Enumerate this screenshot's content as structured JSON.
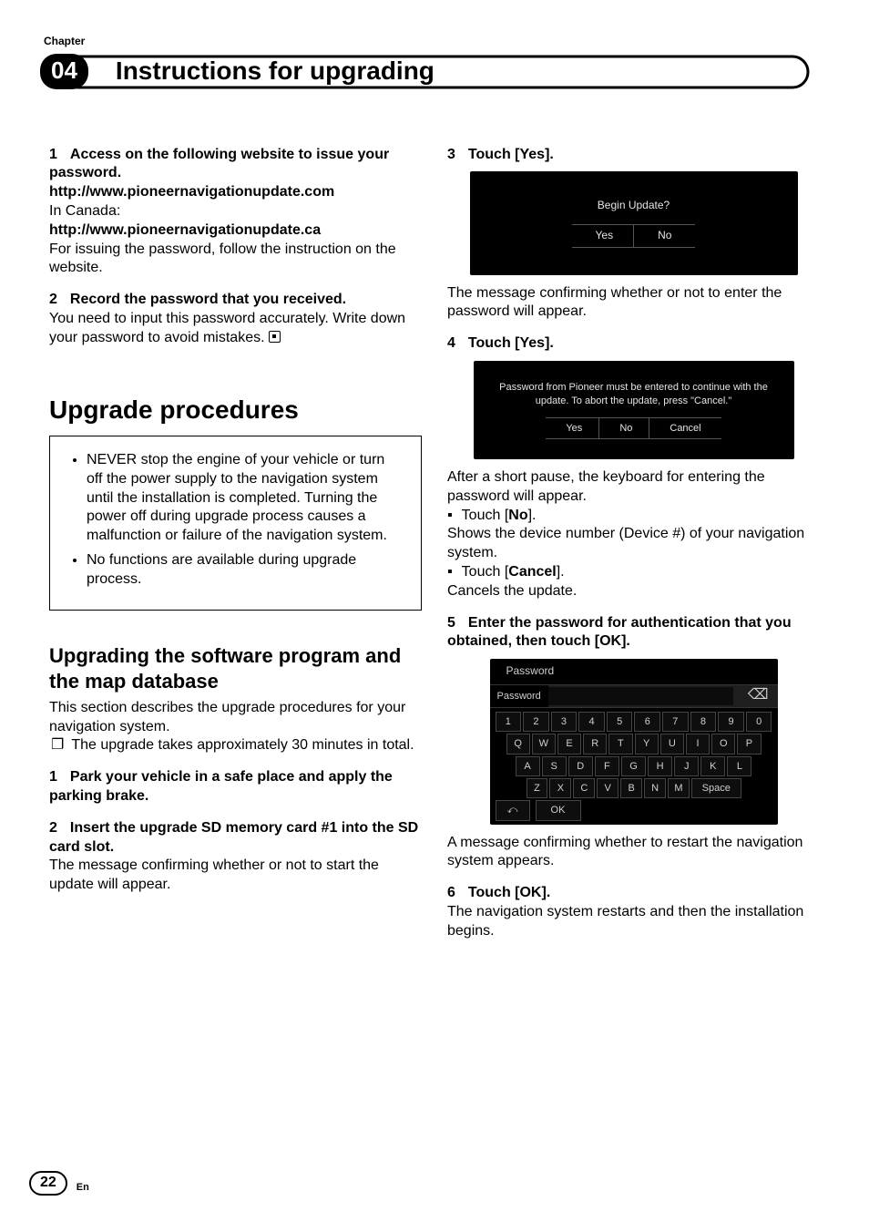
{
  "header": {
    "chapter_label": "Chapter",
    "chapter_num": "04",
    "title": "Instructions for upgrading"
  },
  "left": {
    "s1_heading": "Access on the following website to issue your password.",
    "s1_num": "1",
    "url_us": "http://www.pioneernavigationupdate.com",
    "canada_label": "In Canada:",
    "url_ca": "http://www.pioneernavigationupdate.ca",
    "s1_body": "For issuing the password, follow the instruction on the website.",
    "s2_num": "2",
    "s2_heading": "Record the password that you received.",
    "s2_body": "You need to input this password accurately. Write down your password to avoid mistakes.",
    "section_title": "Upgrade procedures",
    "caution1": "NEVER stop the engine of your vehicle or turn off the power supply to the navigation system until the installation is completed. Turning the power off during upgrade process causes a malfunction or failure of the navigation system.",
    "caution2": "No functions are available during upgrade process.",
    "subsection_title": "Upgrading the software program and the map database",
    "sub_body": "This section describes the upgrade procedures for your navigation system.",
    "note1": "The upgrade takes approximately 30 minutes in total.",
    "l1_num": "1",
    "l1_heading": "Park your vehicle in a safe place and apply the parking brake.",
    "l2_num": "2",
    "l2_heading": "Insert the upgrade SD memory card #1 into the SD card slot.",
    "l2_body": "The message confirming whether or not to start the update will appear."
  },
  "right": {
    "s3_num": "3",
    "s3_heading": "Touch [Yes].",
    "shot1": {
      "msg": "Begin Update?",
      "yes": "Yes",
      "no": "No"
    },
    "s3_body": "The message confirming whether or not to enter the password will appear.",
    "s4_num": "4",
    "s4_heading": "Touch [Yes].",
    "shot2": {
      "msg": "Password from Pioneer must be entered to continue with the update.  To abort the update, press \"Cancel.\"",
      "yes": "Yes",
      "no": "No",
      "cancel": "Cancel"
    },
    "s4_body": "After a short pause, the keyboard for entering the password will appear.",
    "b_no_label": "Touch [",
    "b_no_bold": "No",
    "b_no_after": "].",
    "b_no_body": "Shows the device number (Device #) of your navigation system.",
    "b_cancel_label": "Touch [",
    "b_cancel_bold": "Cancel",
    "b_cancel_after": "].",
    "b_cancel_body": "Cancels the update.",
    "s5_num": "5",
    "s5_heading": "Enter the password for authentication that you obtained, then touch [OK].",
    "shot3": {
      "title": "Password",
      "label": "Password",
      "row1": [
        "1",
        "2",
        "3",
        "4",
        "5",
        "6",
        "7",
        "8",
        "9",
        "0"
      ],
      "row2": [
        "Q",
        "W",
        "E",
        "R",
        "T",
        "Y",
        "U",
        "I",
        "O",
        "P"
      ],
      "row3": [
        "A",
        "S",
        "D",
        "F",
        "G",
        "H",
        "J",
        "K",
        "L"
      ],
      "row4": [
        "Z",
        "X",
        "C",
        "V",
        "B",
        "N",
        "M"
      ],
      "space": "Space",
      "ok": "OK",
      "back": "⤺",
      "bs": "⌫"
    },
    "s5_body": "A message confirming whether to restart the navigation system appears.",
    "s6_num": "6",
    "s6_heading": "Touch [OK].",
    "s6_body": "The navigation system restarts and then the installation begins."
  },
  "footer": {
    "page": "22",
    "lang": "En"
  }
}
